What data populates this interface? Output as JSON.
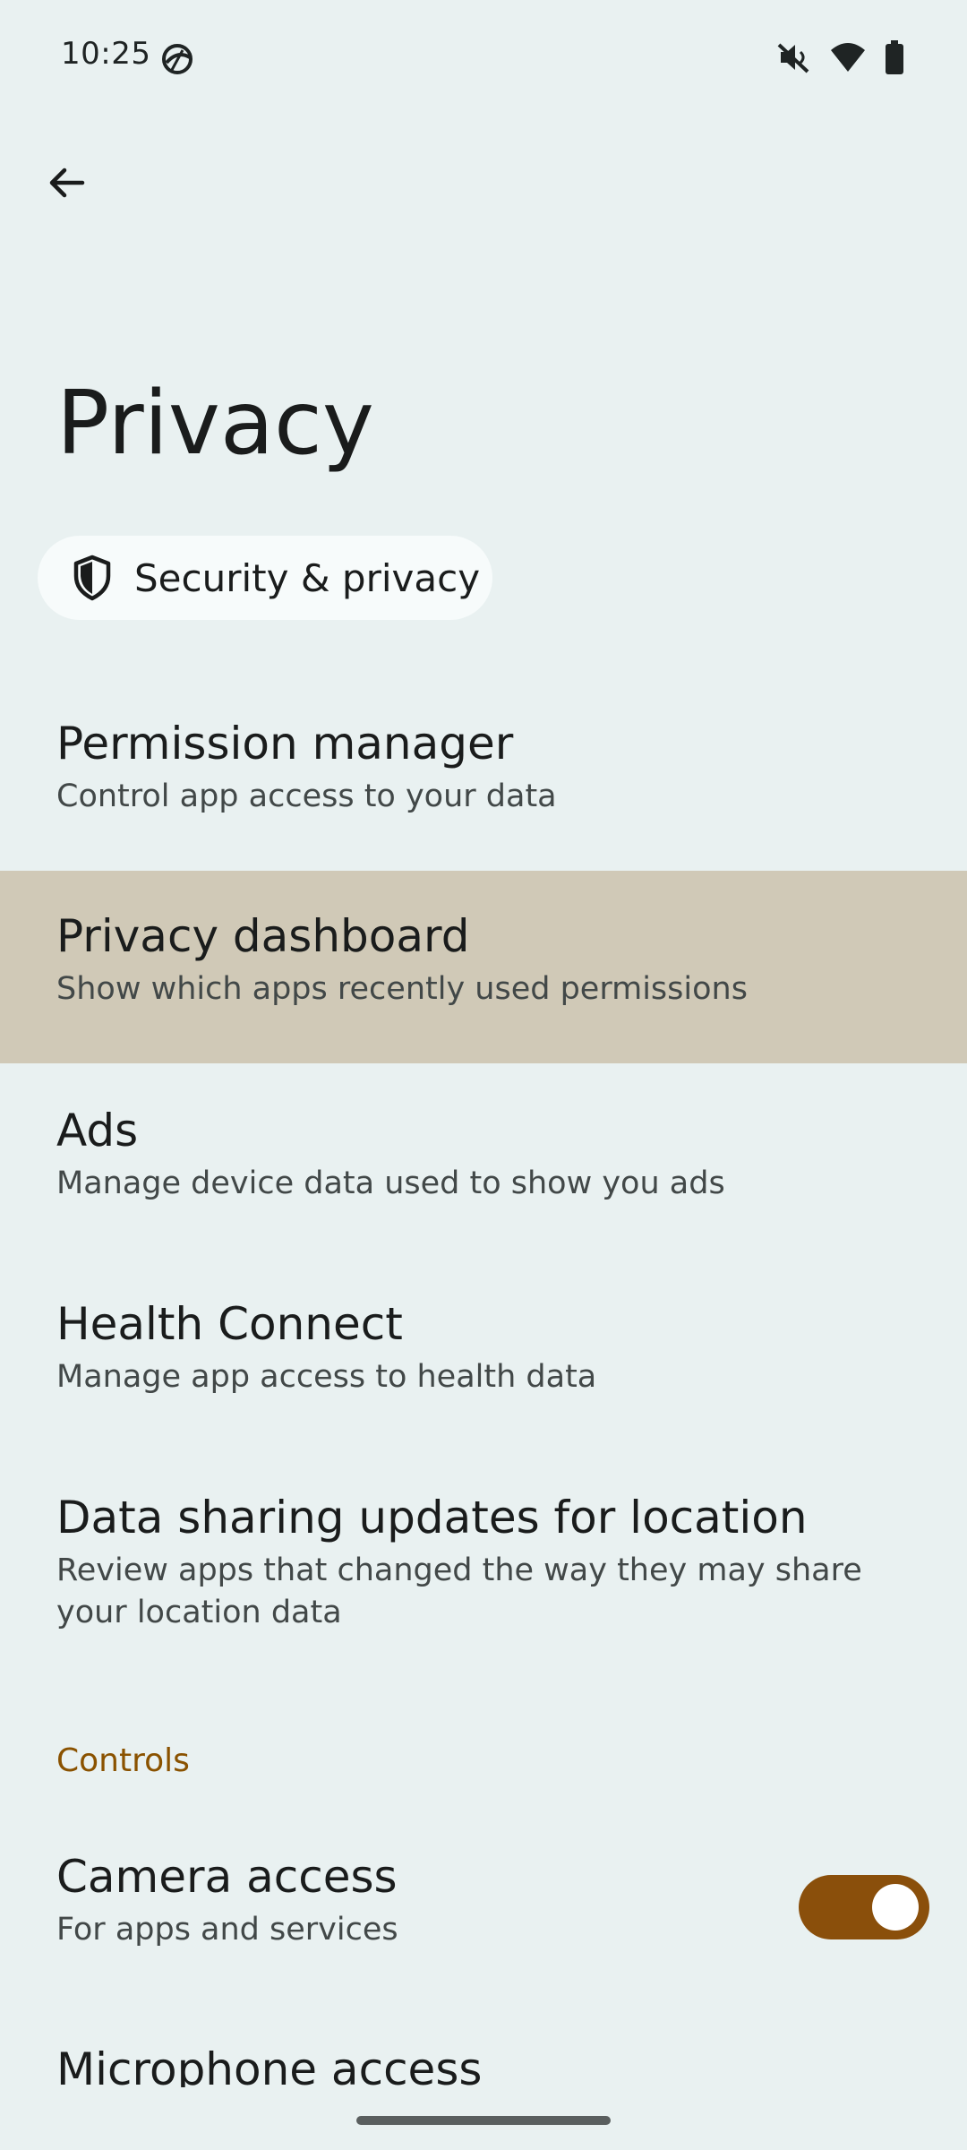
{
  "status_bar": {
    "time": "10:25",
    "icons": [
      "app-notification-icon",
      "vibrate-off-icon",
      "wifi-icon",
      "battery-icon"
    ]
  },
  "app_bar": {
    "back_icon": "arrow-back-icon"
  },
  "page": {
    "title": "Privacy"
  },
  "chip": {
    "icon": "shield-icon",
    "label": "Security & privacy"
  },
  "items": [
    {
      "title": "Permission manager",
      "subtitle": "Control app access to your data"
    },
    {
      "title": "Privacy dashboard",
      "subtitle": "Show which apps recently used permissions"
    },
    {
      "title": "Ads",
      "subtitle": "Manage device data used to show you ads"
    },
    {
      "title": "Health Connect",
      "subtitle": "Manage app access to health data"
    },
    {
      "title": "Data sharing updates for location",
      "subtitle": "Review apps that changed the way they may share your location data"
    }
  ],
  "controls": {
    "header": "Controls",
    "camera": {
      "title": "Camera access",
      "subtitle": "For apps and services",
      "enabled": true
    },
    "microphone": {
      "title": "Microphone access"
    }
  },
  "colors": {
    "background": "#e9f1f1",
    "highlight": "#d0c9b7",
    "accent": "#8a4f0b",
    "section_header": "#8a5200"
  }
}
